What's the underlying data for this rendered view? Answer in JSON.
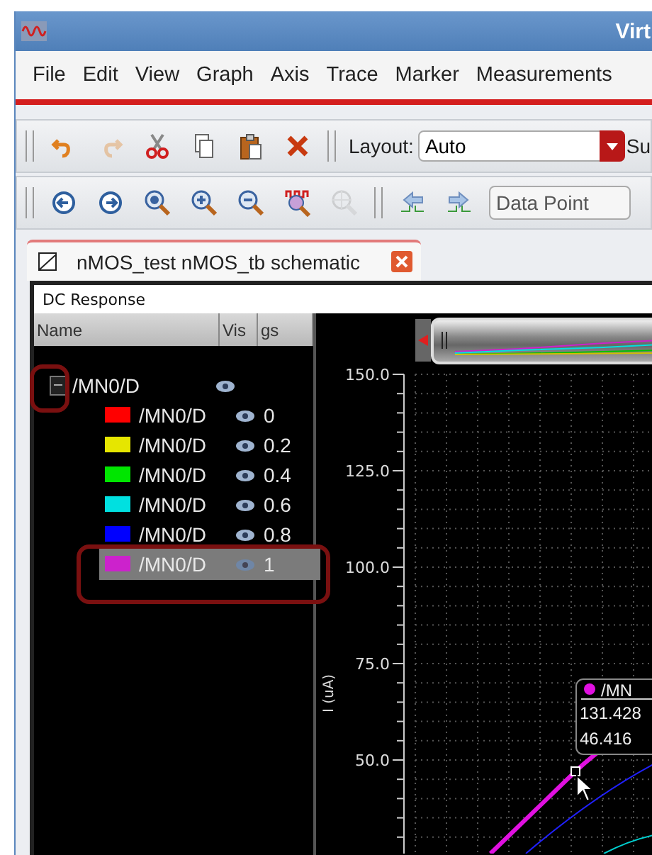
{
  "window": {
    "title": "Virt"
  },
  "menu": [
    "File",
    "Edit",
    "View",
    "Graph",
    "Axis",
    "Trace",
    "Marker",
    "Measurements"
  ],
  "toolbar_1": {
    "buttons": [
      {
        "disabled": false
      },
      {
        "disabled": true
      },
      {
        "disabled": false
      },
      {
        "disabled": false
      },
      {
        "disabled": false
      },
      {
        "disabled": false
      }
    ],
    "layout_label": "Layout:",
    "layout_value": "Auto",
    "cut_label": "Su"
  },
  "toolbar_2": {
    "buttons": [
      {
        "disabled": false
      },
      {
        "disabled": false
      },
      {
        "disabled": false
      },
      {
        "disabled": false
      },
      {
        "disabled": false
      },
      {
        "disabled": false
      },
      {
        "disabled": true
      },
      {
        "disabled": false
      },
      {
        "disabled": false
      }
    ],
    "field_placeholder": "Data Point"
  },
  "tab": {
    "title": "nMOS_test nMOS_tb schematic"
  },
  "panel": {
    "title": "DC Response",
    "columns": [
      "Name",
      "Vis",
      "gs"
    ],
    "tree": {
      "name": "/MN0/D",
      "expanded": true,
      "visible": true,
      "children": [
        {
          "name": "/MN0/D",
          "color": "#ff0000",
          "visible": true,
          "value": "0",
          "selected": false
        },
        {
          "name": "/MN0/D",
          "color": "#e6e600",
          "visible": true,
          "value": "0.2",
          "selected": false
        },
        {
          "name": "/MN0/D",
          "color": "#00e600",
          "visible": true,
          "value": "0.4",
          "selected": false
        },
        {
          "name": "/MN0/D",
          "color": "#00e0e0",
          "visible": true,
          "value": "0.6",
          "selected": false
        },
        {
          "name": "/MN0/D",
          "color": "#0000ff",
          "visible": true,
          "value": "0.8",
          "selected": false
        },
        {
          "name": "/MN0/D",
          "color": "#cc22cc",
          "visible": true,
          "value": "1",
          "selected": true
        }
      ]
    },
    "y_axis": {
      "label": "I (uA)",
      "ticks": [
        "150.0",
        "125.0",
        "100.0",
        "75.0",
        "50.0"
      ]
    },
    "marker": {
      "name": "/MN",
      "x_value": "131.428",
      "y_value": "46.416"
    }
  }
}
